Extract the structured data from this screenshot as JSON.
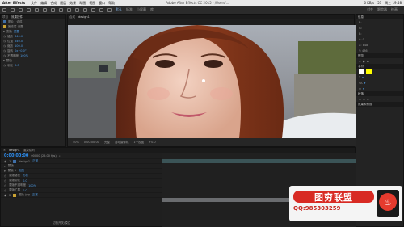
{
  "menubar": {
    "app": "After Effects",
    "items": [
      "文件",
      "编辑",
      "合成",
      "图层",
      "效果",
      "动画",
      "视图",
      "窗口",
      "帮助"
    ],
    "center_title": "Adobe After Effects CC 2015 - /Users/...",
    "right": [
      "0 KB/s",
      "53",
      "周三 19:58"
    ]
  },
  "toolbar": {
    "tabs": [
      "默认",
      "标准",
      "小屏幕",
      "库"
    ],
    "right": [
      "对齐",
      "跟踪器",
      "绘画"
    ]
  },
  "project": {
    "tabs": [
      "项目",
      "效果控件"
    ],
    "header": "图片 · 合成",
    "rows": [
      {
        "label": "固态层 设置",
        "value": ""
      },
      {
        "label": "变换",
        "value": "重置"
      },
      {
        "label": "锚点",
        "value": "640.0"
      },
      {
        "label": "位置",
        "value": "640.0"
      },
      {
        "label": "缩放",
        "value": "100.0"
      },
      {
        "label": "旋转",
        "value": "0x+0.0°"
      },
      {
        "label": "不透明度",
        "value": "100%"
      },
      {
        "label": "蒙版",
        "value": ""
      },
      {
        "label": "羽化",
        "value": "0.0"
      }
    ]
  },
  "viewer": {
    "tabs": [
      "合成",
      "design1"
    ],
    "bottom": [
      "50%",
      "0:00:00:00",
      "完整",
      "活动摄像机",
      "1个视图",
      "+0.0"
    ]
  },
  "right_panel": {
    "title": "信息",
    "rows": [
      "R:",
      "G:",
      "B:",
      "A: 0",
      "X: 848",
      "Y: 436"
    ],
    "sections": [
      "预览",
      "字符",
      "段落",
      "效果和预设"
    ],
    "colors": {
      "fill": "#ffff00",
      "stroke": "#ffffff"
    }
  },
  "timeline": {
    "tabs": [
      "design1",
      "渲染队列"
    ],
    "timecode": "0:00:00:00",
    "fps": "00000 (25.00 fps)",
    "layers": [
      {
        "num": "1",
        "name": "design1",
        "mode": "正常"
      },
      {
        "num": "",
        "name": "蒙版",
        "mode": ""
      },
      {
        "num": "",
        "name": "蒙版 1",
        "mode": "相加"
      },
      {
        "num": "",
        "name": "蒙版路径",
        "mode": "形状"
      },
      {
        "num": "",
        "name": "蒙版羽化",
        "mode": "0.0"
      },
      {
        "num": "",
        "name": "蒙版不透明度",
        "mode": "100%"
      },
      {
        "num": "",
        "name": "蒙版扩展",
        "mode": "0.0"
      },
      {
        "num": "2",
        "name": "图片.jpg",
        "mode": "正常"
      }
    ],
    "footer": "切换开关/模式"
  },
  "watermark": {
    "main": "图穷联盟",
    "qq": "QQ:985303259"
  }
}
